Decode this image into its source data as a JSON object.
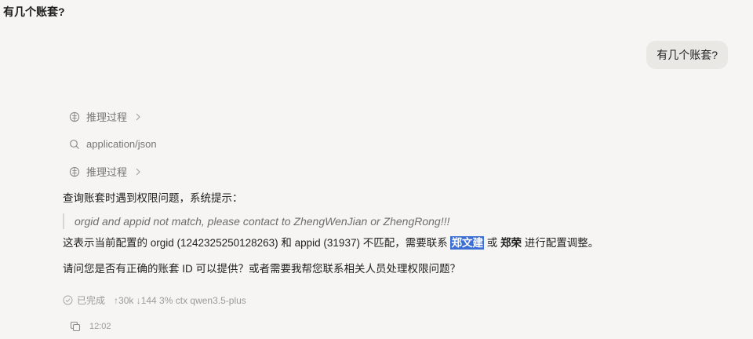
{
  "header": {
    "title": "有几个账套?"
  },
  "user_message": "有几个账套?",
  "steps": [
    {
      "label": "推理过程",
      "icon": "brain-icon"
    },
    {
      "label": "application/json",
      "icon": "search-icon"
    },
    {
      "label": "推理过程",
      "icon": "brain-icon"
    }
  ],
  "response": {
    "line1": "查询账套时遇到权限问题，系统提示：",
    "quote": "orgid and appid not match, please contact to ZhengWenJian or ZhengRong!!!",
    "line2_prefix": "这表示当前配置的 orgid (1242325250128263) 和 appid (31937) 不匹配，需要联系 ",
    "line2_name1": "郑文建",
    "line2_mid": " 或 ",
    "line2_name2": "郑荣",
    "line2_suffix": " 进行配置调整。",
    "line3": "请问您是否有正确的账套 ID 可以提供？或者需要我帮您联系相关人员处理权限问题？"
  },
  "meta": {
    "status": "已完成",
    "tokens": "↑30k ↓144 3% ctx qwen3.5-plus"
  },
  "footer": {
    "time": "12:02"
  },
  "colors": {
    "highlight": "#3b6fd4",
    "background": "#f6f5f3"
  }
}
